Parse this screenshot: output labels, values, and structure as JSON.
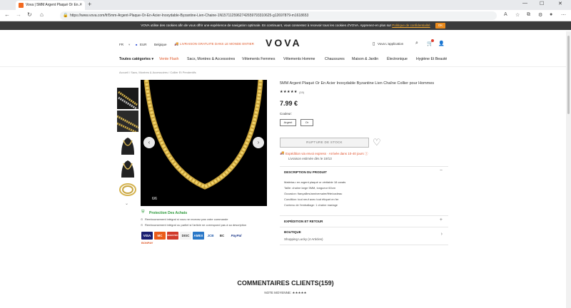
{
  "browser": {
    "tab_title": "Vova | 5MM Argent Plaqué Or En...",
    "url": "https://www.vova.com/fr/5mm-Argent-Plaque-Or-En-Acier-Inoxydable-Byzantine-Lien-Chaine-1N1571125962742659793310625-g12697879-m1618653"
  },
  "cookie": {
    "text": "VOVA utilise des cookies afin de vous offrir une expérience de navigation optimale. En continuant, vous consentez à recevoir tous les cookies d'VOVA. Apprenez-en plus sur",
    "link": "Politique de confidentialité",
    "ok": "OK"
  },
  "header": {
    "lang": "FR",
    "currency": "EUR",
    "country": "Belgique",
    "promo": "LIVRAISON GRATUITE DANS LE MONDE ENTIER",
    "logo": "VOVA",
    "app": "Vova L'application"
  },
  "menu": [
    "Toutes catégories ▾",
    "Vente Flash",
    "Sacs, Montres & Accessoires",
    "Vêtements Femmes",
    "Vêtements Homme",
    "Chaussures",
    "Maison & Jardin",
    "Électronique",
    "Hygiène Et Beauté"
  ],
  "breadcrumb": "Accueil  /  Sacs, Montres & Accessoires  /  Collier Et Pendentifs",
  "product": {
    "title": "5MM Argent Plaqué Or En Acier Inoxydable Byzantine Lien Chaîne Collier pour Hommes",
    "stars": "★★★★★",
    "review_count": "(19)",
    "price": "7.99 €",
    "color_label": "Couleur:",
    "colors": [
      "Argent",
      "Or"
    ],
    "image_counter": "6/6",
    "oos": "RUPTURE DE STOCK",
    "ship_line": "Expédition via envoi express · Arrivée dans 10-40 jours ⓘ",
    "ship_line2": "Livraison estimée dès le 19/13"
  },
  "sections": {
    "desc_title": "DESCRIPTION DU PRODUIT",
    "desc_lines": [
      "Matériau: en argent plaqué or véritable 18 carats",
      "Taille: chaîne large 5MM, longueur 60cm",
      "Occasion: fiançailles/anniversaire/fête/cadeau",
      "Condition: tout neuf avec tout étiquet en fer",
      "Contenu de l'emballage: 1 chaîne mariage"
    ],
    "ship_title": "EXPÉDITION ET RETOUR",
    "shop_title": "BOUTIQUE",
    "shop_name": "Shopping Lucky (4 Articles)"
  },
  "protection": {
    "title": "Protection Des Achats",
    "lines": [
      "Remboursement intégral si vous ne recevez pas votre commande",
      "Remboursement intégral ou partiel si l'article ne correspond pas à sa description"
    ]
  },
  "payments": [
    "VISA",
    "MC",
    "MAESTRO",
    "DISC",
    "AMEX",
    "JCB",
    "BC",
    "PayPal"
  ],
  "footer_badge": "BONPAY",
  "reviews": {
    "title": "COMMENTAIRES CLIENTS(159)",
    "rating": "NOTE MOYENNE: ★★★★★"
  }
}
